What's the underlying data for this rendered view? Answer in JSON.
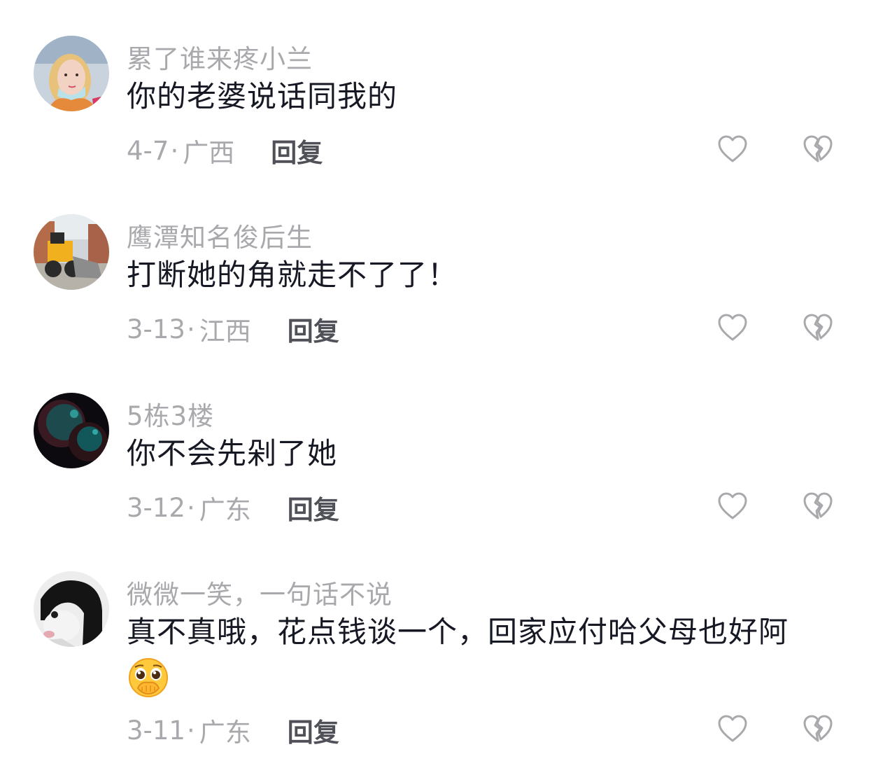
{
  "comments": [
    {
      "username": "累了谁来疼小兰",
      "text": "你的老婆说话同我的",
      "date": "4-7",
      "location": "广西",
      "reply_label": "回复",
      "avatar": "woman-selfie"
    },
    {
      "username": "鹰潭知名俊后生",
      "text": "打断她的角就走不了了！",
      "date": "3-13",
      "location": "江西",
      "reply_label": "回复",
      "avatar": "wheel-loader"
    },
    {
      "username": "5栋3楼",
      "text": "你不会先剁了她",
      "date": "3-12",
      "location": "广东",
      "reply_label": "回复",
      "avatar": "dark-planets"
    },
    {
      "username": "微微一笑，一句话不说",
      "text": "真不真哦，花点钱谈一个，回家应付哈父母也好阿",
      "emoji": "pleading-face-covering-mouth",
      "date": "3-11",
      "location": "广东",
      "reply_label": "回复",
      "avatar": "black-white-cat"
    }
  ],
  "separator": "·",
  "icons": {
    "like": "heart-outline-icon",
    "dislike": "broken-heart-outline-icon"
  },
  "colors": {
    "username": "#a9a9ad",
    "text": "#161823",
    "reply": "#4f5058"
  }
}
